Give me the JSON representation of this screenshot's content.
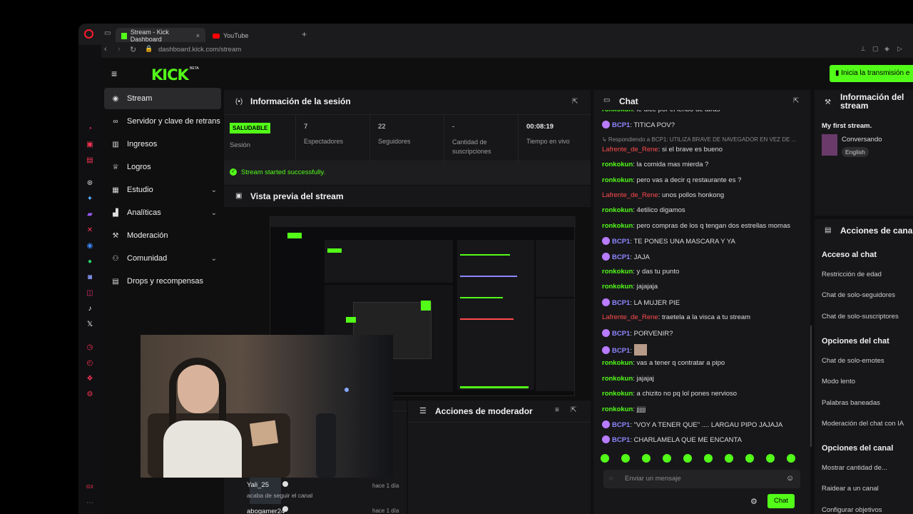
{
  "browser": {
    "tabs": [
      {
        "label": "Stream - Kick Dashboard",
        "active": true
      },
      {
        "label": "YouTube",
        "active": false
      }
    ],
    "url": "dashboard.kick.com/stream"
  },
  "header": {
    "logo": "KICK",
    "beta": "BETA",
    "start_button": "Inicia la transmisión e"
  },
  "sidebar": {
    "items": [
      {
        "label": "Stream",
        "icon": "broadcast-icon"
      },
      {
        "label": "Servidor y clave de retrans",
        "icon": "link-icon"
      },
      {
        "label": "Ingresos",
        "icon": "chart-bar-icon"
      },
      {
        "label": "Logros",
        "icon": "trophy-icon"
      },
      {
        "label": "Estudio",
        "icon": "grid-icon"
      },
      {
        "label": "Analíticas",
        "icon": "analytics-icon"
      },
      {
        "label": "Moderación",
        "icon": "wrench-icon"
      },
      {
        "label": "Comunidad",
        "icon": "community-icon"
      },
      {
        "label": "Drops y recompensas",
        "icon": "gift-icon"
      }
    ]
  },
  "session": {
    "title": "Información de la sesión",
    "status_badge": "SALUDABLE",
    "session_label": "Sesión",
    "stats": [
      {
        "value": "7",
        "label": "Espectadores"
      },
      {
        "value": "22",
        "label": "Seguidores"
      },
      {
        "value": "-",
        "label": "Cantidad de suscripciones"
      },
      {
        "value": "00:08:19",
        "label": "Tiempo en vivo"
      }
    ],
    "success_message": "Stream started successfully."
  },
  "preview": {
    "title": "Vista previa del stream"
  },
  "moderator": {
    "title": "Acciones de moderador"
  },
  "activity": [
    {
      "user": "Yali_25",
      "action": "acaba de seguir el canal",
      "time": "hace 1 día"
    },
    {
      "user": "abogamer24",
      "action": "",
      "time": "hace 1 día"
    }
  ],
  "chat": {
    "title": "Chat",
    "reply_note": "Respondiendo a BCP1: UTILIZA BRAVE DE NAVEGADOR EN VEZ DE ...",
    "messages": [
      {
        "user": "ronkokun",
        "text": "le dice por el lenbo de atras",
        "color": "green",
        "badge": false
      },
      {
        "user": "BCP1",
        "text": "TITICA POV?",
        "color": "blue",
        "badge": true
      },
      {
        "user": "Lafrente_de_Rene",
        "text": "si el brave es bueno",
        "color": "red",
        "badge": false
      },
      {
        "user": "ronkokun",
        "text": "la comida mas mierda ?",
        "color": "green",
        "badge": false
      },
      {
        "user": "ronkokun",
        "text": "pero vas a decir q restaurante es ?",
        "color": "green",
        "badge": false
      },
      {
        "user": "Lafrente_de_Rene",
        "text": "unos pollos honkong",
        "color": "red",
        "badge": false
      },
      {
        "user": "ronkokun",
        "text": "4etilico digamos",
        "color": "green",
        "badge": false
      },
      {
        "user": "ronkokun",
        "text": "pero compras de los q tengan dos estrellas momas",
        "color": "green",
        "badge": false
      },
      {
        "user": "BCP1",
        "text": "TE PONES UNA MASCARA Y YA",
        "color": "blue",
        "badge": true
      },
      {
        "user": "BCP1",
        "text": "JAJA",
        "color": "blue",
        "badge": true
      },
      {
        "user": "ronkokun",
        "text": "y das tu punto",
        "color": "green",
        "badge": false
      },
      {
        "user": "ronkokun",
        "text": "jajajaja",
        "color": "green",
        "badge": false
      },
      {
        "user": "BCP1",
        "text": "LA MUJER PIE",
        "color": "blue",
        "badge": true
      },
      {
        "user": "Lafrente_de_Rene",
        "text": "traetela a la visca a tu stream",
        "color": "red",
        "badge": false
      },
      {
        "user": "BCP1",
        "text": "PORVENIR?",
        "color": "blue",
        "badge": true
      },
      {
        "user": "BCP1",
        "text": "",
        "color": "blue",
        "badge": true
      },
      {
        "user": "ronkokun",
        "text": "vas a tener q contratar a pipo",
        "color": "green",
        "badge": false
      },
      {
        "user": "ronkokun",
        "text": "jajajaj",
        "color": "green",
        "badge": false
      },
      {
        "user": "ronkokun",
        "text": "a chizito no pq lol pones nervioso",
        "color": "green",
        "badge": false
      },
      {
        "user": "ronkokun",
        "text": "jjjjjj",
        "color": "green",
        "badge": false
      },
      {
        "user": "BCP1",
        "text": "\"VOY A TENER QUE\" .... LARGAU PIPO JAJAJA",
        "color": "blue",
        "badge": true
      },
      {
        "user": "BCP1",
        "text": "CHARLAMELA QUE ME ENCANTA",
        "color": "blue",
        "badge": true
      }
    ],
    "input_placeholder": "Enviar un mensaje",
    "send_button": "Chat"
  },
  "stream_info": {
    "title": "Información del stream",
    "stream_title": "My first stream.",
    "category": "Conversando",
    "language": "English"
  },
  "channel_actions": {
    "title": "Acciones de cana",
    "sections": [
      {
        "heading": "Acceso al chat",
        "items": [
          "Restricción de edad",
          "Chat de solo-seguidores",
          "Chat de solo-suscriptores"
        ]
      },
      {
        "heading": "Opciones del chat",
        "items": [
          "Chat de solo-emotes",
          "Modo lento",
          "Palabras baneadas",
          "Moderación del chat con IA"
        ]
      },
      {
        "heading": "Opciones del canal",
        "items": [
          "Mostrar cantidad de...",
          "Raidear a un canal",
          "Configurar objetivos"
        ]
      }
    ]
  },
  "colors": {
    "accent": "#53fc18",
    "panel": "#17171a",
    "red_user": "#ff4b4b",
    "blue_user": "#8e86ff"
  }
}
